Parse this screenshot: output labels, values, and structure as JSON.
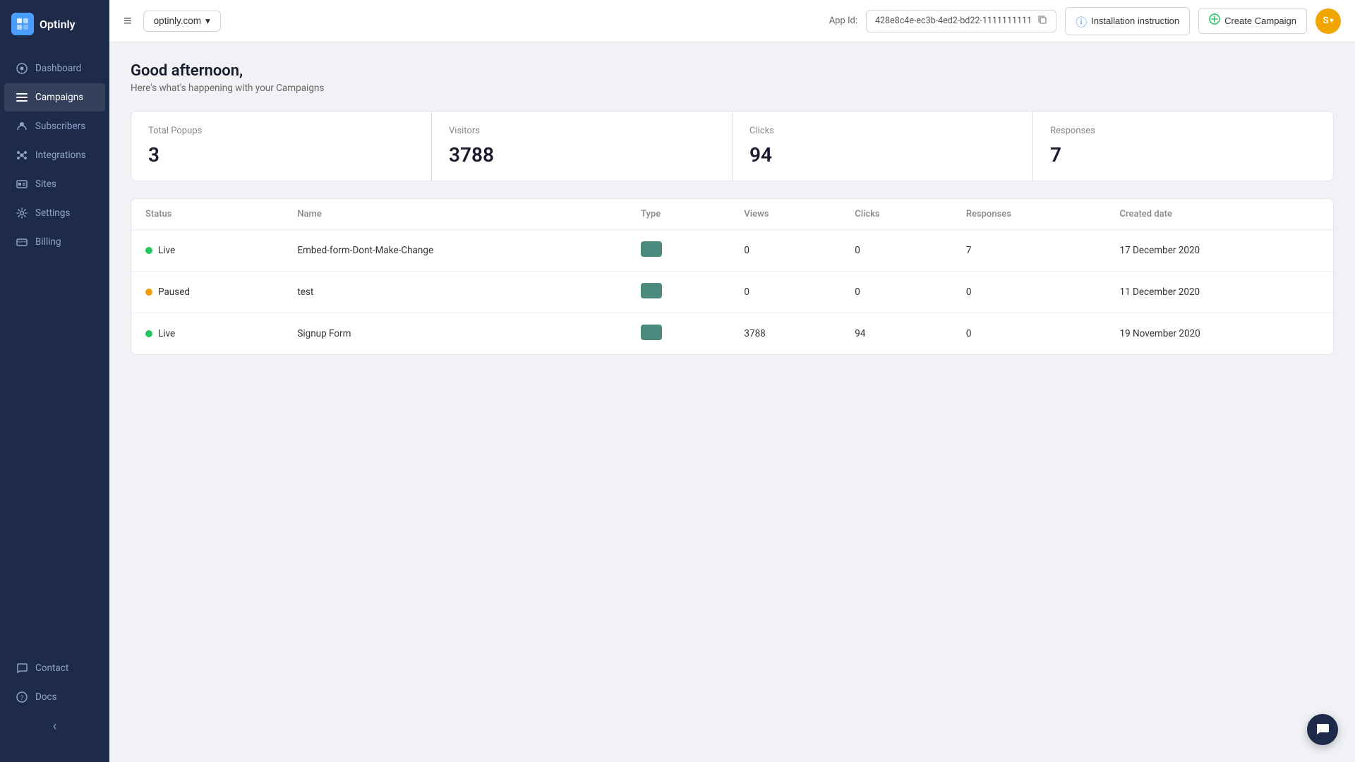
{
  "app": {
    "logo_text": "Optinly",
    "logo_abbr": "O"
  },
  "sidebar": {
    "items": [
      {
        "id": "dashboard",
        "label": "Dashboard",
        "icon": "⊙",
        "active": false
      },
      {
        "id": "campaigns",
        "label": "Campaigns",
        "icon": "☰",
        "active": true
      },
      {
        "id": "subscribers",
        "label": "Subscribers",
        "icon": "✿",
        "active": false
      },
      {
        "id": "integrations",
        "label": "Integrations",
        "icon": "⚙",
        "active": false
      },
      {
        "id": "sites",
        "label": "Sites",
        "icon": "▣",
        "active": false
      },
      {
        "id": "settings",
        "label": "Settings",
        "icon": "⚙",
        "active": false
      },
      {
        "id": "billing",
        "label": "Billing",
        "icon": "▭",
        "active": false
      }
    ],
    "bottom_items": [
      {
        "id": "contact",
        "label": "Contact",
        "icon": "💬"
      },
      {
        "id": "docs",
        "label": "Docs",
        "icon": "❓"
      }
    ],
    "collapse_label": "‹"
  },
  "header": {
    "hamburger_icon": "≡",
    "domain": "optinly.com",
    "dropdown_icon": "▾",
    "app_id_label": "App Id:",
    "app_id_value": "428e8c4e-ec3b-4ed2-bd22-1111111111",
    "copy_icon": "⎘",
    "install_btn": "Installation instruction",
    "install_icon": "⊕",
    "create_btn": "Create Campaign",
    "create_icon": "+",
    "user_initials": "S",
    "user_dropdown_icon": "▾"
  },
  "main": {
    "greeting": "Good afternoon,",
    "greeting_sub": "Here's what's happening with your Campaigns",
    "stats": [
      {
        "label": "Total Popups",
        "value": "3"
      },
      {
        "label": "Visitors",
        "value": "3788"
      },
      {
        "label": "Clicks",
        "value": "94"
      },
      {
        "label": "Responses",
        "value": "7"
      }
    ],
    "table": {
      "columns": [
        "Status",
        "Name",
        "Type",
        "Views",
        "Clicks",
        "Responses",
        "Created date"
      ],
      "rows": [
        {
          "status": "Live",
          "status_type": "live",
          "name": "Embed-form-Dont-Make-Change",
          "type_icon": "form",
          "views": "0",
          "clicks": "0",
          "responses": "7",
          "created_date": "17 December 2020"
        },
        {
          "status": "Paused",
          "status_type": "paused",
          "name": "test",
          "type_icon": "form",
          "views": "0",
          "clicks": "0",
          "responses": "0",
          "created_date": "11 December 2020"
        },
        {
          "status": "Live",
          "status_type": "live",
          "name": "Signup Form",
          "type_icon": "form",
          "views": "3788",
          "clicks": "94",
          "responses": "0",
          "created_date": "19 November 2020"
        }
      ]
    }
  },
  "chat_widget": {
    "icon": "💬"
  }
}
